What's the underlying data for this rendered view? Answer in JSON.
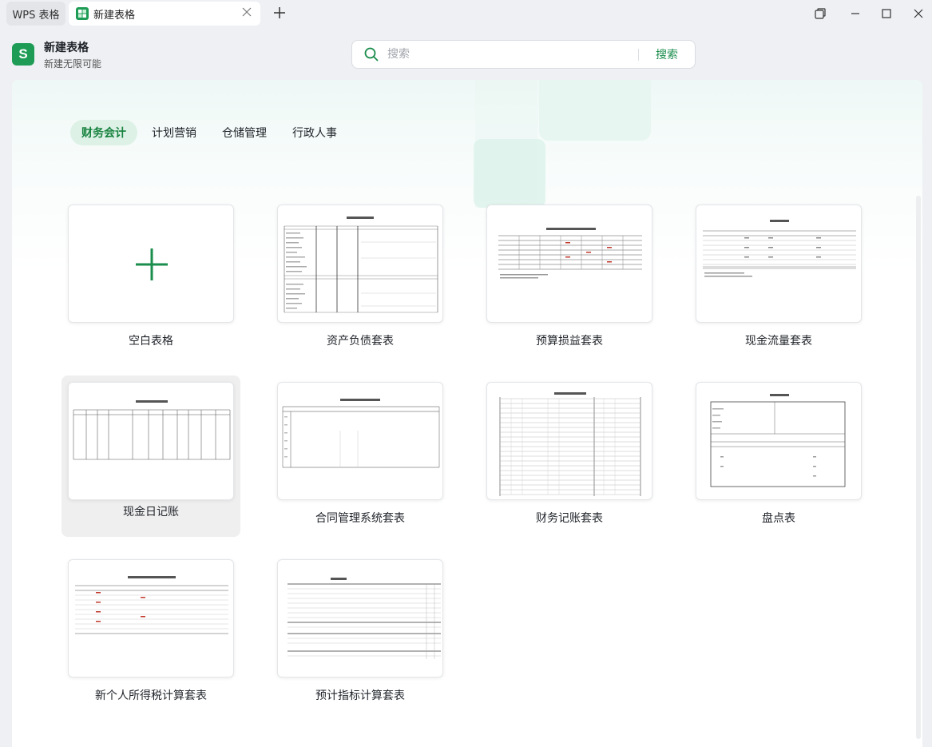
{
  "titlebar": {
    "app_tab": "WPS 表格",
    "doc_tab": "新建表格",
    "icons": [
      "spreadsheet-icon",
      "close-icon",
      "plus-icon",
      "restore-window-icon",
      "minimize-icon",
      "maximize-icon",
      "close-window-icon"
    ]
  },
  "header": {
    "logo_letter": "S",
    "title": "新建表格",
    "subtitle": "新建无限可能"
  },
  "search": {
    "placeholder": "搜索",
    "button": "搜索"
  },
  "categories": [
    "财务会计",
    "计划营销",
    "仓储管理",
    "行政人事"
  ],
  "active_category": "财务会计",
  "templates": [
    {
      "label": "空白表格"
    },
    {
      "label": "资产负债套表"
    },
    {
      "label": "预算损益套表"
    },
    {
      "label": "现金流量套表"
    },
    {
      "label": "现金日记账"
    },
    {
      "label": "合同管理系统套表"
    },
    {
      "label": "财务记账套表"
    },
    {
      "label": "盘点表"
    },
    {
      "label": "新个人所得税计算套表"
    },
    {
      "label": "预计指标计算套表"
    }
  ],
  "colors": {
    "accent": "#1b8d4d",
    "logo": "#1e9c55",
    "active_tab_bg": "#ddf1e6"
  }
}
